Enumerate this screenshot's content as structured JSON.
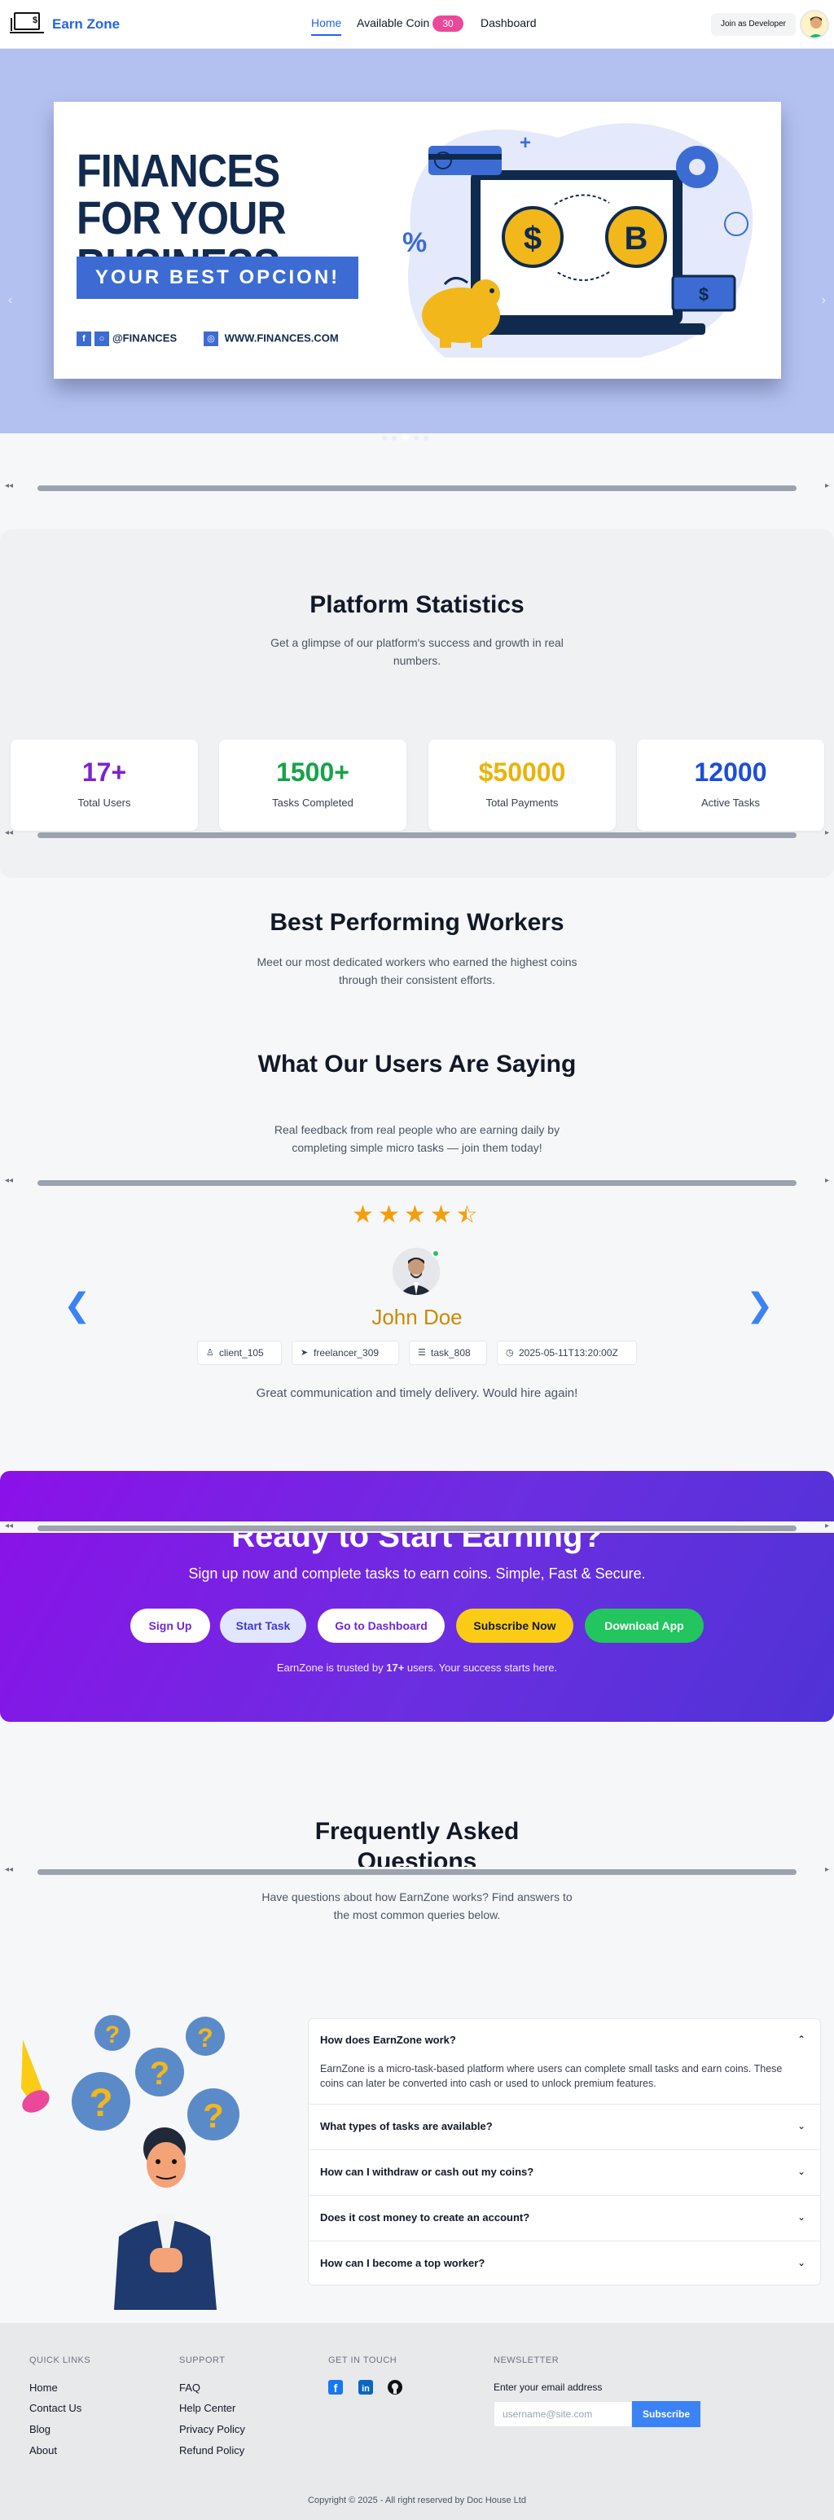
{
  "nav": {
    "brand": "Earn Zone",
    "home": "Home",
    "coin_label": "Available Coin",
    "coin_count": "30",
    "dashboard": "Dashboard",
    "developer_button": "Join as Developer"
  },
  "hero": {
    "title": "FINANCES FOR YOUR BUSINESS",
    "button": "YOUR BEST OPCION!",
    "handle": "@FINANCES",
    "website": "WWW.FINANCES.COM",
    "slide_count": 5,
    "active_slide": 3
  },
  "stats": {
    "title": "Platform Statistics",
    "subtitle": "Get a glimpse of our platform's success and growth in real numbers.",
    "cards": [
      {
        "value": "17+",
        "label": "Total Users",
        "color": "#7e22ce"
      },
      {
        "value": "1500+",
        "label": "Tasks Completed",
        "color": "#16a34a"
      },
      {
        "value": "$50000",
        "label": "Total Payments",
        "color": "#eab308"
      },
      {
        "value": "12000",
        "label": "Active Tasks",
        "color": "#1d4ed8"
      }
    ]
  },
  "workers": {
    "title": "Best Performing Workers",
    "subtitle": "Meet our most dedicated workers who earned the highest coins through their consistent efforts."
  },
  "testimonials": {
    "title": "What Our Users Are Saying",
    "subtitle": "Real feedback from real people who are earning daily by completing simple micro tasks — join them today!",
    "rating": 4.5,
    "name": "John Doe",
    "chips": [
      "client_105",
      "freelancer_309",
      "task_808",
      "2025-05-11T13:20:00Z"
    ],
    "quote": "Great communication and timely delivery. Would hire again!"
  },
  "cta": {
    "title": "Ready to Start Earning?",
    "subtitle": "Sign up now and complete tasks to earn coins. Simple, Fast & Secure.",
    "buttons": [
      "Sign Up",
      "Start Task",
      "Go to Dashboard",
      "Subscribe Now",
      "Download App"
    ],
    "note_prefix": "EarnZone is trusted by ",
    "note_count": "17+",
    "note_suffix": " users. Your success starts here."
  },
  "faq": {
    "title": "Frequently Asked Questions",
    "subtitle": "Have questions about how EarnZone works? Find answers to the most common queries below.",
    "items": [
      {
        "q": "How does EarnZone work?",
        "a": "EarnZone is a micro-task-based platform where users can complete small tasks and earn coins. These coins can later be converted into cash or used to unlock premium features."
      },
      {
        "q": "What types of tasks are available?"
      },
      {
        "q": "How can I withdraw or cash out my coins?"
      },
      {
        "q": "Does it cost money to create an account?"
      },
      {
        "q": "How can I become a top worker?"
      }
    ]
  },
  "footer": {
    "quick_links_title": "QUICK LINKS",
    "quick_links": [
      "Home",
      "Contact Us",
      "Blog",
      "About"
    ],
    "support_title": "SUPPORT",
    "support_links": [
      "FAQ",
      "Help Center",
      "Privacy Policy",
      "Refund Policy"
    ],
    "touch_title": "GET IN TOUCH",
    "newsletter_title": "NEWSLETTER",
    "newsletter_label": "Enter your email address",
    "newsletter_placeholder": "username@site.com",
    "subscribe": "Subscribe",
    "copyright": "Copyright © 2025 - All right reserved by Doc House Ltd"
  }
}
